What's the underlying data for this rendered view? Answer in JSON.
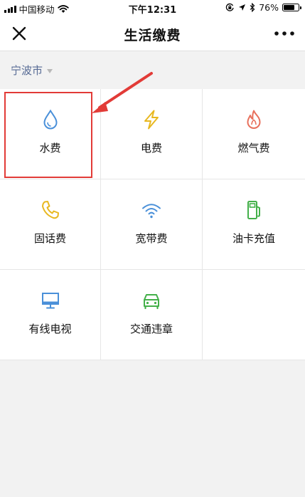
{
  "status_bar": {
    "carrier": "中国移动",
    "time": "下午12:31",
    "battery_percent": "76%",
    "battery_level": 0.76
  },
  "nav": {
    "title": "生活缴费",
    "close_icon": "close-icon",
    "more_icon": "more-icon"
  },
  "city": {
    "name": "宁波市"
  },
  "services": [
    {
      "label": "水费",
      "icon": "water-drop-icon",
      "color": "#4a90d9"
    },
    {
      "label": "电费",
      "icon": "lightning-icon",
      "color": "#e8b820"
    },
    {
      "label": "燃气费",
      "icon": "flame-icon",
      "color": "#e8705c"
    },
    {
      "label": "固话费",
      "icon": "phone-icon",
      "color": "#e8b820"
    },
    {
      "label": "宽带费",
      "icon": "wifi-icon",
      "color": "#4a90d9"
    },
    {
      "label": "油卡充值",
      "icon": "fuel-pump-icon",
      "color": "#44b04a"
    },
    {
      "label": "有线电视",
      "icon": "tv-icon",
      "color": "#4a90d9"
    },
    {
      "label": "交通违章",
      "icon": "car-icon",
      "color": "#44b04a"
    }
  ],
  "annotation": {
    "highlight_color": "#e23b37"
  }
}
